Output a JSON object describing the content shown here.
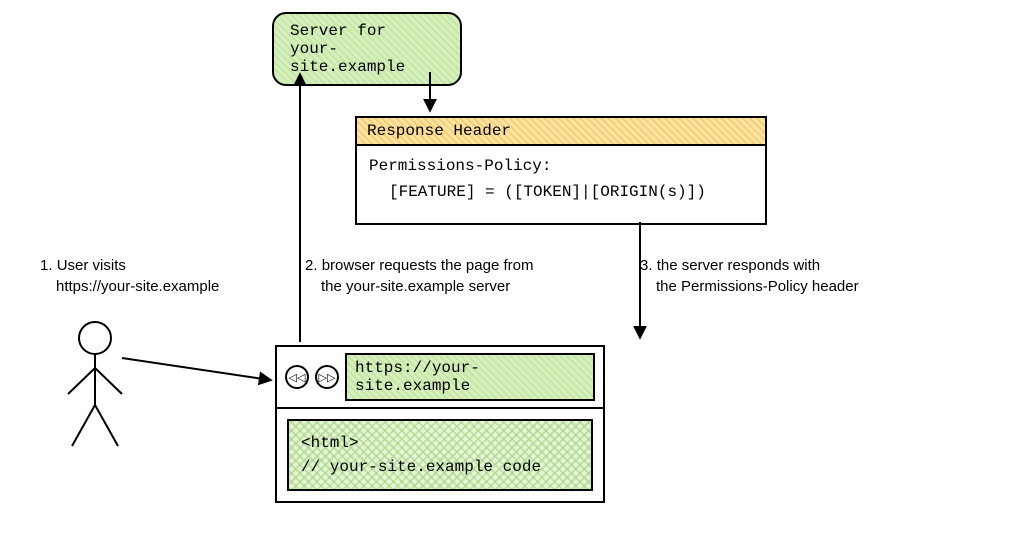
{
  "server": {
    "line1": "Server for",
    "line2": "your-site.example"
  },
  "response": {
    "title": "Response Header",
    "line1": "Permissions-Policy:",
    "line2": "[FEATURE] = ([TOKEN]|[ORIGIN(s)])"
  },
  "steps": {
    "s1_num": "1.",
    "s1_l1": "User visits",
    "s1_l2": "https://your-site.example",
    "s2_num": "2.",
    "s2_l1": "browser requests the page from",
    "s2_l2": "the your-site.example server",
    "s3_num": "3.",
    "s3_l1": "the server responds with",
    "s3_l2": "the Permissions-Policy header"
  },
  "browser": {
    "back_glyph": "◁◁",
    "fwd_glyph": "▷▷",
    "address": "https://your-site.example",
    "code_l1": "<html>",
    "code_l2": "// your-site.example code"
  }
}
